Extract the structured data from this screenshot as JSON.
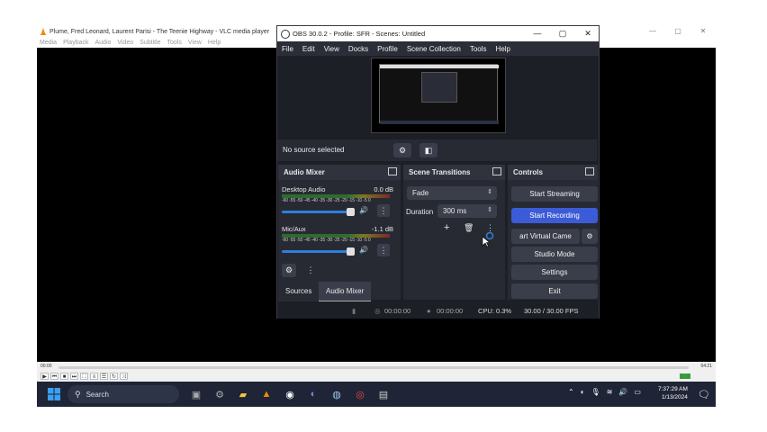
{
  "vlc": {
    "title": "Plume, Fred Leonard, Laurent Parisi - The Teenie Highway - VLC media player",
    "menu": [
      "Media",
      "Playback",
      "Audio",
      "Video",
      "Subtitle",
      "Tools",
      "View",
      "Help"
    ],
    "time_elapsed": "00:00",
    "time_total": "04:21"
  },
  "obs": {
    "title": "OBS 30.0.2 - Profile: SFR - Scenes: Untitled",
    "menu": [
      "File",
      "Edit",
      "View",
      "Docks",
      "Profile",
      "Scene Collection",
      "Tools",
      "Help"
    ],
    "source_status": "No source selected",
    "audio_mixer": {
      "title": "Audio Mixer",
      "scale": "-60 -55 -50 -45 -40 -35 -30 -25 -20 -15 -10 -5 0",
      "channels": [
        {
          "name": "Desktop Audio",
          "db": "0.0 dB"
        },
        {
          "name": "Mic/Aux",
          "db": "-1.1 dB"
        }
      ]
    },
    "scene_transitions": {
      "title": "Scene Transitions",
      "transition": "Fade",
      "duration_label": "Duration",
      "duration_value": "300 ms"
    },
    "controls": {
      "title": "Controls",
      "start_streaming": "Start Streaming",
      "start_recording": "Start Recording",
      "virtual_camera": "art Virtual Came",
      "studio_mode": "Studio Mode",
      "settings": "Settings",
      "exit": "Exit"
    },
    "tabs": [
      "Sources",
      "Audio Mixer"
    ],
    "status": {
      "stream_time": "00:00:00",
      "record_time": "00:00:00",
      "cpu": "CPU: 0.3%",
      "fps": "30.00 / 30.00 FPS"
    }
  },
  "taskbar": {
    "search_label": "Search",
    "time": "7:37:29 AM",
    "date": "1/13/2024"
  },
  "colors": {
    "obs_accent": "#3c5bd6",
    "taskbar_bg": "#1f2536"
  }
}
